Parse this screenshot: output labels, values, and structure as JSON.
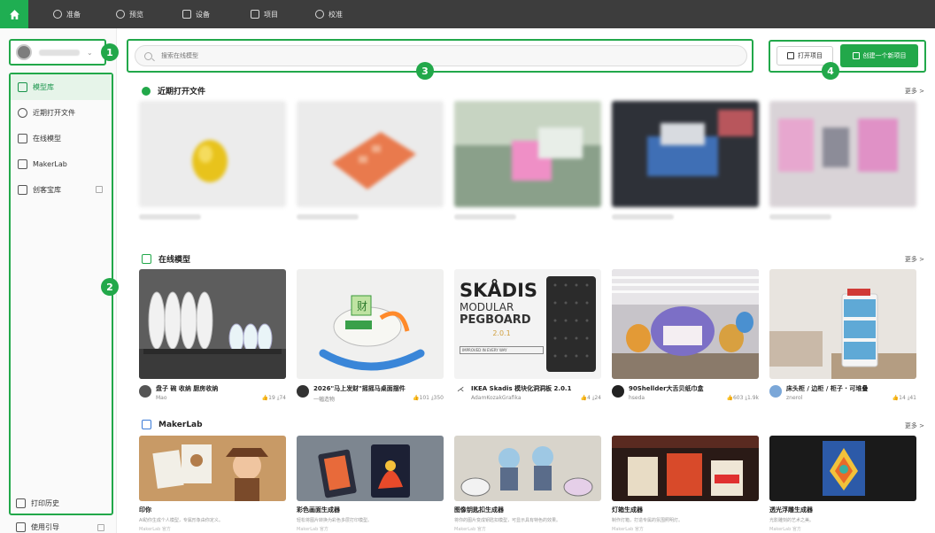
{
  "topnav": {
    "items": [
      {
        "label": "准备"
      },
      {
        "label": "预览"
      },
      {
        "label": "设备"
      },
      {
        "label": "项目"
      },
      {
        "label": "校准"
      }
    ]
  },
  "sidebar": {
    "items": [
      {
        "label": "模型库"
      },
      {
        "label": "近期打开文件"
      },
      {
        "label": "在线模型"
      },
      {
        "label": "MakerLab"
      },
      {
        "label": "创客宝库"
      }
    ],
    "bottom": [
      {
        "label": "打印历史"
      },
      {
        "label": "使用引导"
      }
    ]
  },
  "markers": [
    "1",
    "2",
    "3",
    "4"
  ],
  "search": {
    "placeholder": "搜索在线模型"
  },
  "actions": {
    "open_label": "打开项目",
    "new_label": "创建一个新项目"
  },
  "sections": {
    "recent": {
      "title": "近期打开文件",
      "more": "更多 >"
    },
    "online": {
      "title": "在线模型",
      "more": "更多 >"
    },
    "maker": {
      "title": "MakerLab",
      "more": "更多 >"
    }
  },
  "online_models": [
    {
      "title": "盘子 碗 收纳 厨房收纳",
      "author": "Mao",
      "stats": "👍19 ⤓74"
    },
    {
      "title": "2026\"马上发财\"摇摇马桌面摆件",
      "author": "一幅造物",
      "stats": "👍101 ⤓350"
    },
    {
      "title": "IKEA Skadis 模块化洞洞板 2.0.1",
      "author": "AdamKozakGrafika",
      "stats": "👍4 ⤓24"
    },
    {
      "title": "90Shellder大舌贝纸巾盒",
      "author": "hseda",
      "stats": "👍603 ⤓1.9k"
    },
    {
      "title": "床头柜 / 边柜 / 柜子 · 可堆叠",
      "author": "znerol",
      "stats": "👍14 ⤓41"
    }
  ],
  "skadis": {
    "line1": "SKÅDIS",
    "line2": "MODULAR",
    "line3": "PEGBOARD",
    "line4": "2.0.1",
    "tag": "IMPROVED IN EVERY WAY"
  },
  "makerlab": [
    {
      "title": "印你",
      "desc": "AI助你生成个人模型，专属形象由你定义。",
      "tag": "MakerLab 官方"
    },
    {
      "title": "彩色画面生成器",
      "desc": "轻松将图片转换为彩色多层打印模型。",
      "tag": "MakerLab 官方"
    },
    {
      "title": "图像钥匙扣生成器",
      "desc": "将你的图片变成钥匙扣模型，可显示具有特色的效果。",
      "tag": "MakerLab 官方"
    },
    {
      "title": "灯箱生成器",
      "desc": "制作灯箱，打造专属的氛围照明灯。",
      "tag": "MakerLab 官方"
    },
    {
      "title": "透光浮雕生成器",
      "desc": "光影雕刻的艺术之美。",
      "tag": "MakerLab 官方"
    }
  ]
}
